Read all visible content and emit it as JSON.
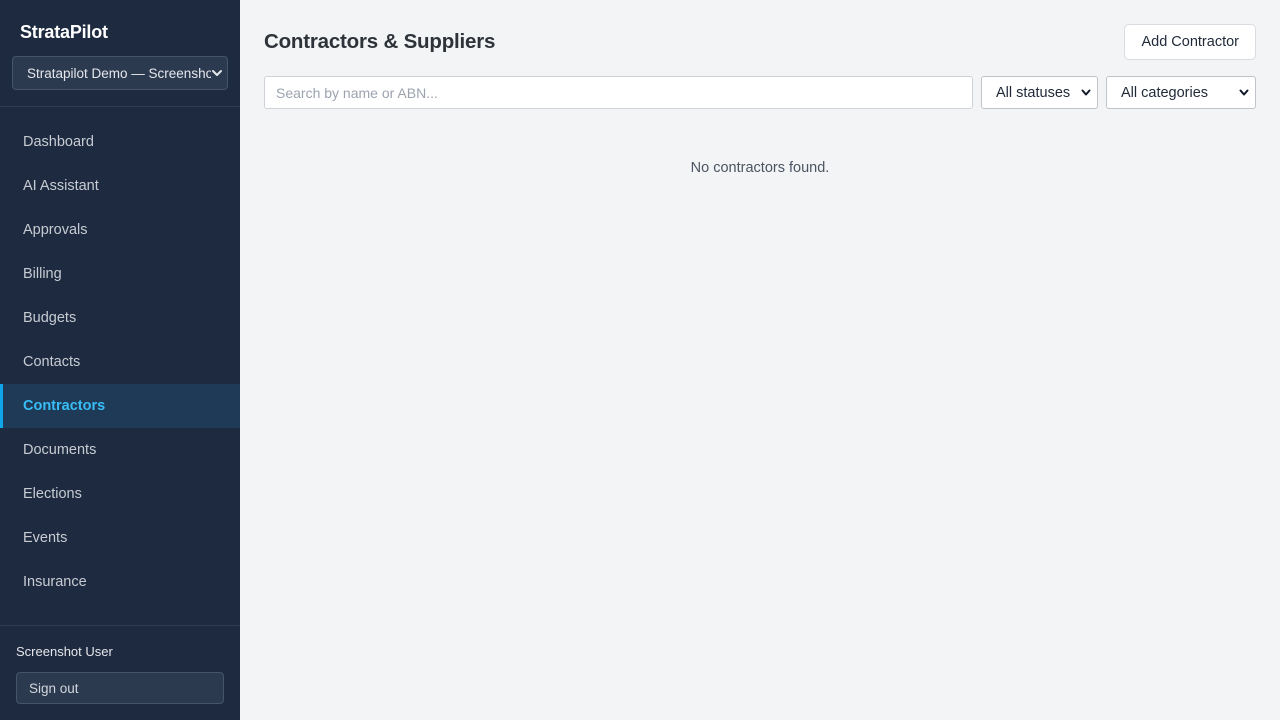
{
  "sidebar": {
    "brand": "StrataPilot",
    "org_selector": {
      "value": "Stratapilot Demo — Screenshot"
    },
    "items": [
      {
        "label": "Dashboard",
        "active": false
      },
      {
        "label": "AI Assistant",
        "active": false
      },
      {
        "label": "Approvals",
        "active": false
      },
      {
        "label": "Billing",
        "active": false
      },
      {
        "label": "Budgets",
        "active": false
      },
      {
        "label": "Contacts",
        "active": false
      },
      {
        "label": "Contractors",
        "active": true
      },
      {
        "label": "Documents",
        "active": false
      },
      {
        "label": "Elections",
        "active": false
      },
      {
        "label": "Events",
        "active": false
      },
      {
        "label": "Insurance",
        "active": false
      }
    ],
    "user": {
      "name": "Screenshot User",
      "sign_out_label": "Sign out"
    }
  },
  "main": {
    "title": "Contractors & Suppliers",
    "add_button_label": "Add Contractor",
    "search": {
      "placeholder": "Search by name or ABN...",
      "value": ""
    },
    "status_filter": {
      "selected": "All statuses"
    },
    "category_filter": {
      "selected": "All categories"
    },
    "empty_message": "No contractors found."
  },
  "colors": {
    "sidebar_bg": "#1e2a3f",
    "accent": "#38bdf8",
    "active_bg": "#1e3a56",
    "main_bg": "#f3f4f6"
  }
}
